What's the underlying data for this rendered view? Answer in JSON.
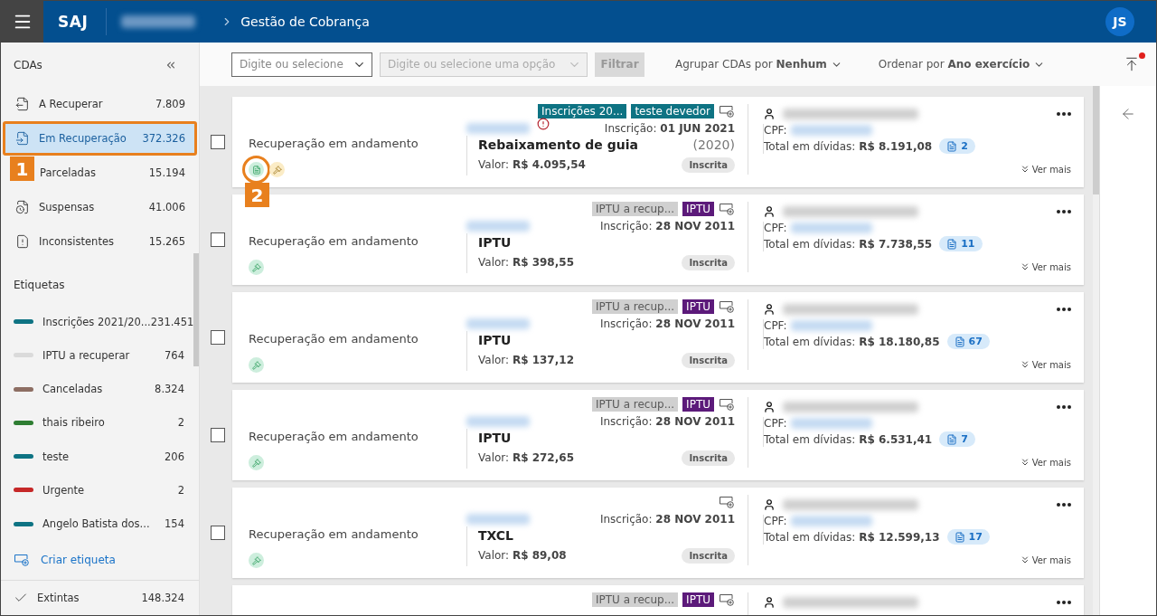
{
  "topbar": {
    "brand": "SAJ",
    "title": "Gestão de Cobrança",
    "avatar": "JS"
  },
  "toolbar": {
    "select_1": {
      "placeholder": "Digite ou selecione",
      "disabled": false
    },
    "select_2": {
      "placeholder": "Digite ou selecione uma opção",
      "disabled": true
    },
    "filter_button": {
      "label": "Filtrar",
      "disabled": true
    },
    "group_by": {
      "label": "Agrupar CDAs por",
      "value": "Nenhum"
    },
    "order_by": {
      "label": "Ordenar por",
      "value": "Ano exercício"
    },
    "export_notification": true
  },
  "sidebar": {
    "title": "CDAs",
    "items": [
      {
        "kind": "to-recover",
        "label": "A Recuperar",
        "count": "7.809",
        "selected": false
      },
      {
        "kind": "recovering",
        "label": "Em Recuperação",
        "count": "372.326",
        "selected": true,
        "callout": "1"
      },
      {
        "label": "Parceladas",
        "count": "15.194",
        "selected": false
      },
      {
        "kind": "suspended",
        "label": "Suspensas",
        "count": "41.006",
        "selected": false
      },
      {
        "kind": "inconsistent",
        "label": "Inconsistentes",
        "count": "15.265",
        "selected": false
      }
    ],
    "labels_title": "Etiquetas",
    "labels": [
      {
        "label": "Inscrições 2021/20...",
        "count": "231.451",
        "color": "#0e7383"
      },
      {
        "label": "IPTU a recuperar",
        "count": "764",
        "color": "#dadada"
      },
      {
        "label": "Canceladas",
        "count": "8.324",
        "color": "#8d6e63"
      },
      {
        "label": "thais ribeiro",
        "count": "2",
        "color": "#2e7d32"
      },
      {
        "label": "teste",
        "count": "206",
        "color": "#0e7383"
      },
      {
        "label": "Urgente",
        "count": "2",
        "color": "#c62828"
      },
      {
        "label": "Angelo Batista dos...",
        "count": "154",
        "color": "#0e7383"
      }
    ],
    "create_label": "Criar etiqueta",
    "footer": {
      "label": "Extintas",
      "count": "148.324"
    }
  },
  "cards": [
    {
      "checked": false,
      "status": "Recuperação em andamento",
      "icons": [
        {
          "kind": "document",
          "callout": "2"
        },
        {
          "kind": "gavel-pending"
        }
      ],
      "alert": true,
      "tags": [
        {
          "label": "Inscrições 20...",
          "color": "#0e7383"
        },
        {
          "label": "teste devedor",
          "color": "#0e7383"
        }
      ],
      "date_label": "Inscrição:",
      "date": "01 JUN 2021",
      "title": "Rebaixamento de guia",
      "year": "(2020)",
      "value_label": "Valor:",
      "value": "R$ 4.095,54",
      "pill": "Inscrita",
      "cpf_label": "CPF:",
      "debt_label": "Total em dívidas:",
      "debt": "R$ 8.191,08",
      "docs": "2",
      "more": "Ver mais"
    },
    {
      "checked": false,
      "status": "Recuperação em andamento",
      "icons": [
        {
          "kind": "gavel"
        }
      ],
      "alert": false,
      "tags": [
        {
          "label": "IPTU a recup...",
          "color": "#d0d0d0"
        },
        {
          "label": "IPTU",
          "color": "#5c1a7a"
        }
      ],
      "date_label": "Inscrição:",
      "date": "28 NOV 2011",
      "title": "IPTU",
      "value_label": "Valor:",
      "value": "R$ 398,55",
      "pill": "Inscrita",
      "cpf_label": "CPF:",
      "debt_label": "Total em dívidas:",
      "debt": "R$ 7.738,55",
      "docs": "11",
      "more": "Ver mais"
    },
    {
      "checked": false,
      "status": "Recuperação em andamento",
      "icons": [
        {
          "kind": "gavel"
        }
      ],
      "alert": false,
      "tags": [
        {
          "label": "IPTU a recup...",
          "color": "#d0d0d0"
        },
        {
          "label": "IPTU",
          "color": "#5c1a7a"
        }
      ],
      "date_label": "Inscrição:",
      "date": "28 NOV 2011",
      "title": "IPTU",
      "value_label": "Valor:",
      "value": "R$ 137,12",
      "pill": "Inscrita",
      "cpf_label": "CPF:",
      "debt_label": "Total em dívidas:",
      "debt": "R$ 18.180,85",
      "docs": "67",
      "more": "Ver mais"
    },
    {
      "checked": false,
      "status": "Recuperação em andamento",
      "icons": [
        {
          "kind": "gavel"
        }
      ],
      "alert": false,
      "tags": [
        {
          "label": "IPTU a recup...",
          "color": "#d0d0d0"
        },
        {
          "label": "IPTU",
          "color": "#5c1a7a"
        }
      ],
      "date_label": "Inscrição:",
      "date": "28 NOV 2011",
      "title": "IPTU",
      "value_label": "Valor:",
      "value": "R$ 272,65",
      "pill": "Inscrita",
      "cpf_label": "CPF:",
      "debt_label": "Total em dívidas:",
      "debt": "R$ 6.531,41",
      "docs": "7",
      "more": "Ver mais"
    },
    {
      "checked": false,
      "status": "Recuperação em andamento",
      "icons": [
        {
          "kind": "gavel"
        }
      ],
      "alert": false,
      "date_label": "Inscrição:",
      "date": "28 NOV 2011",
      "title": "TXCL",
      "value_label": "Valor:",
      "value": "R$ 89,08",
      "pill": "Inscrita",
      "cpf_label": "CPF:",
      "debt_label": "Total em dívidas:",
      "debt": "R$ 12.599,13",
      "docs": "17",
      "more": "Ver mais"
    },
    {
      "tags": [
        {
          "label": "IPTU a recup...",
          "color": "#d0d0d0"
        },
        {
          "label": "IPTU",
          "color": "#5c1a7a"
        }
      ]
    }
  ]
}
